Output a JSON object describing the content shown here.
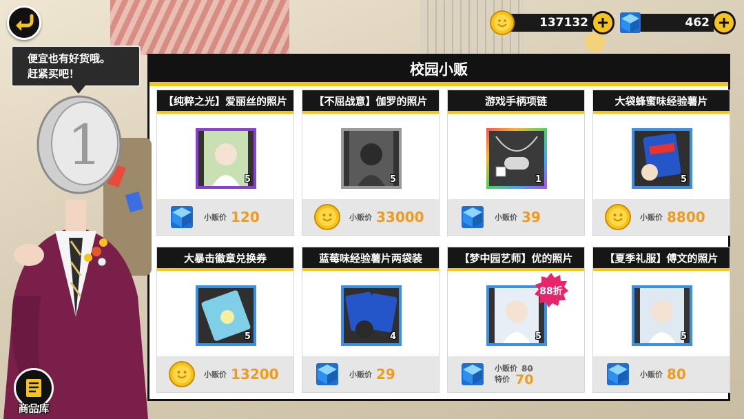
{
  "currency": {
    "coins": "137132",
    "gems": "462"
  },
  "bubble": {
    "line1": "便宜也有好货哦。",
    "line2": "赶紧买吧！"
  },
  "shop": {
    "title": "校园小贩",
    "price_label": "小贩价",
    "special_label": "特价",
    "items": [
      {
        "name": "【纯粹之光】爱丽丝的照片",
        "count": "5",
        "currency": "gem",
        "price": "120",
        "icon": "photo-card-icon",
        "frame": "purple"
      },
      {
        "name": "【不屈战意】伽罗的照片",
        "count": "5",
        "currency": "coin",
        "price": "33000",
        "icon": "photo-card-icon",
        "frame": "gray"
      },
      {
        "name": "游戏手柄项链",
        "count": "1",
        "currency": "gem",
        "price": "39",
        "icon": "gamepad-necklace-icon",
        "frame": "rainbow"
      },
      {
        "name": "大袋蜂蜜味经验薯片",
        "count": "5",
        "currency": "coin",
        "price": "8800",
        "icon": "chips-bag-icon",
        "frame": "blue"
      },
      {
        "name": "大暴击徽章兑换券",
        "count": "5",
        "currency": "coin",
        "price": "13200",
        "icon": "ticket-icon",
        "frame": "blue"
      },
      {
        "name": "蓝莓味经验薯片两袋装",
        "count": "4",
        "currency": "gem",
        "price": "29",
        "icon": "chips-double-icon",
        "frame": "blue"
      },
      {
        "name": "【梦中园艺师】优的照片",
        "count": "5",
        "currency": "gem",
        "old_price": "80",
        "price": "70",
        "discount": "88折",
        "icon": "photo-card-icon",
        "frame": "blue"
      },
      {
        "name": "【夏季礼服】傅文的照片",
        "count": "5",
        "currency": "gem",
        "price": "80",
        "icon": "photo-card-icon",
        "frame": "blue"
      }
    ]
  },
  "catalog_label": "商品库",
  "colors": {
    "accent_yellow": "#f7c61d",
    "price_orange": "#f29a1a",
    "gem_blue": "#3b8fe4"
  }
}
